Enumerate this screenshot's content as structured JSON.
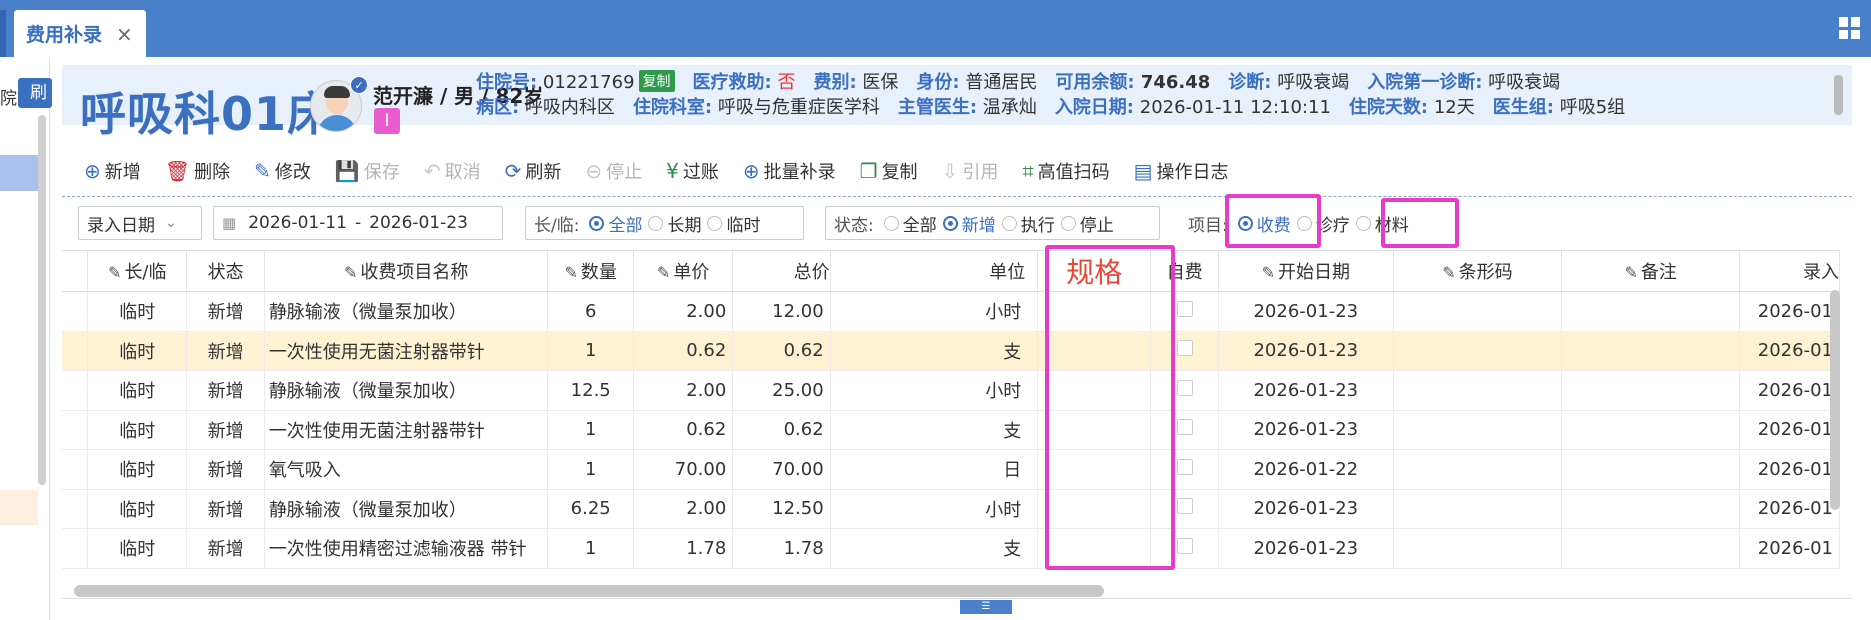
{
  "tab": {
    "label": "费用补录",
    "close": "×"
  },
  "left": {
    "text": "院",
    "button": "刷"
  },
  "patient": {
    "bed": "呼吸科01床",
    "name_line": "范开濂 / 男 / 82岁",
    "tag": "I",
    "row1": [
      {
        "k": "住院号:",
        "v": "01221769",
        "extra": "复制"
      },
      {
        "k": "医疗救助:",
        "v": "否",
        "red": true
      },
      {
        "k": "费别:",
        "v": "医保"
      },
      {
        "k": "身份:",
        "v": "普通居民"
      },
      {
        "k": "可用余额:",
        "v": "746.48",
        "bold": true
      },
      {
        "k": "诊断:",
        "v": "呼吸衰竭"
      },
      {
        "k": "入院第一诊断:",
        "v": "呼吸衰竭"
      }
    ],
    "row2": [
      {
        "k": "病区:",
        "v": "呼吸内科区"
      },
      {
        "k": "住院科室:",
        "v": "呼吸与危重症医学科"
      },
      {
        "k": "主管医生:",
        "v": "温承灿"
      },
      {
        "k": "入院日期:",
        "v": "2026-01-11 12:10:11"
      },
      {
        "k": "住院天数:",
        "v": "12天"
      },
      {
        "k": "医生组:",
        "v": "呼吸5组"
      }
    ]
  },
  "toolbar": [
    {
      "label": "新增",
      "icon": "⊕",
      "name": "add-button",
      "state": "enabled"
    },
    {
      "label": "删除",
      "icon": "🗑",
      "name": "delete-button",
      "state": "enabled"
    },
    {
      "label": "修改",
      "icon": "✎",
      "name": "edit-button",
      "state": "enabled"
    },
    {
      "label": "保存",
      "icon": "💾",
      "name": "save-button",
      "state": "disabled"
    },
    {
      "label": "取消",
      "icon": "↶",
      "name": "cancel-button",
      "state": "disabled"
    },
    {
      "label": "刷新",
      "icon": "⟳",
      "name": "refresh-button",
      "state": "enabled"
    },
    {
      "label": "停止",
      "icon": "⊖",
      "name": "stop-button",
      "state": "disabled"
    },
    {
      "label": "过账",
      "icon": "¥",
      "name": "post-button",
      "state": "enabled"
    },
    {
      "label": "批量补录",
      "icon": "⊕",
      "name": "batch-add-button",
      "state": "enabled"
    },
    {
      "label": "复制",
      "icon": "❐",
      "name": "copy-button",
      "state": "enabled"
    },
    {
      "label": "引用",
      "icon": "⇩",
      "name": "reference-button",
      "state": "disabled"
    },
    {
      "label": "高值扫码",
      "icon": "⌗",
      "name": "scan-button",
      "state": "enabled"
    },
    {
      "label": "操作日志",
      "icon": "▤",
      "name": "log-button",
      "state": "enabled"
    }
  ],
  "filters": {
    "date_type": "录入日期",
    "date_from": "2026-01-11",
    "date_sep": "-",
    "date_to": "2026-01-23",
    "longtemp_label": "长/临:",
    "longtemp": [
      {
        "label": "全部",
        "on": true
      },
      {
        "label": "长期",
        "on": false
      },
      {
        "label": "临时",
        "on": false
      }
    ],
    "status_label": "状态:",
    "status": [
      {
        "label": "全部",
        "on": false
      },
      {
        "label": "新增",
        "on": true
      },
      {
        "label": "执行",
        "on": false
      },
      {
        "label": "停止",
        "on": false
      }
    ],
    "item_label": "项目:",
    "items": [
      {
        "label": "收费",
        "on": true
      },
      {
        "label": "诊疗",
        "on": false
      },
      {
        "label": "材料",
        "on": false
      }
    ]
  },
  "table": {
    "columns": [
      "长/临",
      "状态",
      "收费项目名称",
      "数量",
      "单价",
      "总价",
      "单位",
      "规格",
      "自费",
      "开始日期",
      "条形码",
      "备注",
      "录入"
    ],
    "rows": [
      {
        "lt": "临时",
        "status": "新增",
        "name": "静脉输液（微量泵加收）",
        "qty": "6",
        "price": "2.00",
        "total": "12.00",
        "unit": "小时",
        "date": "2026-01-23",
        "entry": "2026-01"
      },
      {
        "lt": "临时",
        "status": "新增",
        "name": "一次性使用无菌注射器带针",
        "qty": "1",
        "price": "0.62",
        "total": "0.62",
        "unit": "支",
        "date": "2026-01-23",
        "entry": "2026-01"
      },
      {
        "lt": "临时",
        "status": "新增",
        "name": "静脉输液（微量泵加收）",
        "qty": "12.5",
        "price": "2.00",
        "total": "25.00",
        "unit": "小时",
        "date": "2026-01-23",
        "entry": "2026-01"
      },
      {
        "lt": "临时",
        "status": "新增",
        "name": "一次性使用无菌注射器带针",
        "qty": "1",
        "price": "0.62",
        "total": "0.62",
        "unit": "支",
        "date": "2026-01-23",
        "entry": "2026-01"
      },
      {
        "lt": "临时",
        "status": "新增",
        "name": "氧气吸入",
        "qty": "1",
        "price": "70.00",
        "total": "70.00",
        "unit": "日",
        "date": "2026-01-22",
        "entry": "2026-01"
      },
      {
        "lt": "临时",
        "status": "新增",
        "name": "静脉输液（微量泵加收）",
        "qty": "6.25",
        "price": "2.00",
        "total": "12.50",
        "unit": "小时",
        "date": "2026-01-23",
        "entry": "2026-01"
      },
      {
        "lt": "临时",
        "status": "新增",
        "name": "一次性使用精密过滤输液器 带针",
        "qty": "1",
        "price": "1.78",
        "total": "1.78",
        "unit": "支",
        "date": "2026-01-23",
        "entry": "2026-01"
      }
    ],
    "highlight_row": 1
  },
  "colors": {
    "accent": "#3b6fc0",
    "magenta": "#e83cc8",
    "spec_red": "#e8473a",
    "highlight": "#fdf3d3"
  }
}
